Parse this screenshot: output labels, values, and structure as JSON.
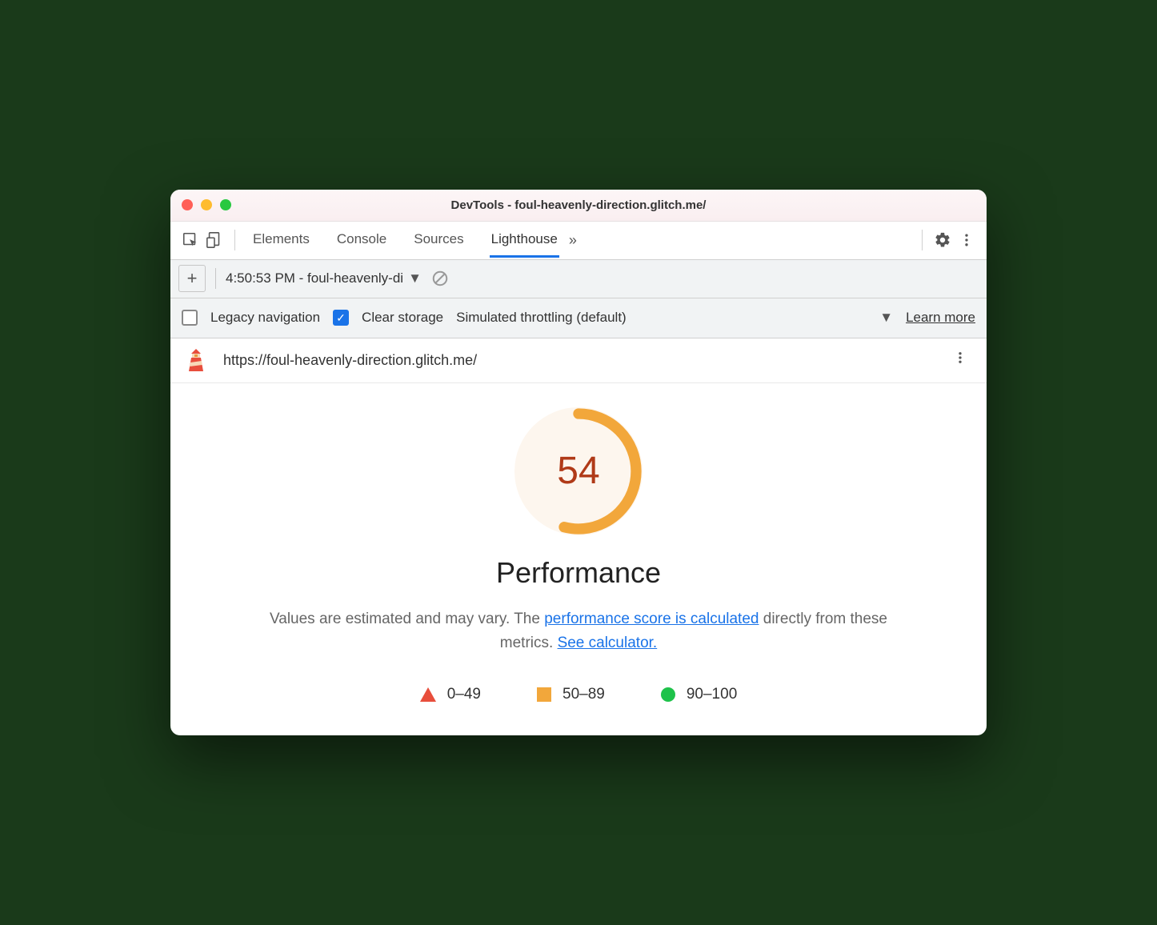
{
  "window": {
    "title": "DevTools - foul-heavenly-direction.glitch.me/"
  },
  "tabs": {
    "elements": "Elements",
    "console": "Console",
    "sources": "Sources",
    "lighthouse": "Lighthouse"
  },
  "subbar": {
    "report_label": "4:50:53 PM - foul-heavenly-di"
  },
  "options": {
    "legacy": "Legacy navigation",
    "clear": "Clear storage",
    "throttle": "Simulated throttling (default)",
    "learn": "Learn more"
  },
  "url": "https://foul-heavenly-direction.glitch.me/",
  "perf": {
    "score": "54",
    "title": "Performance",
    "desc_pre": "Values are estimated and may vary. The ",
    "link1": "performance score is calculated",
    "desc_mid": " directly from these metrics. ",
    "link2": "See calculator."
  },
  "legend": {
    "low": "0–49",
    "mid": "50–89",
    "high": "90–100"
  },
  "colors": {
    "accent_orange": "#f2a73b"
  }
}
